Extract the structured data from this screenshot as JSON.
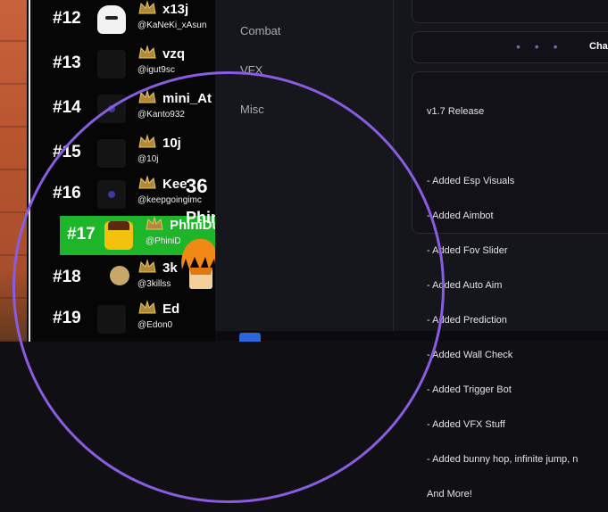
{
  "leaderboard": [
    {
      "rank": "#12",
      "name": "x13j",
      "handle": "@KaNeKi_xAsun",
      "avatar": "ghost"
    },
    {
      "rank": "#13",
      "name": "vzq",
      "handle": "@igut9sc",
      "avatar": "dark"
    },
    {
      "rank": "#14",
      "name": "mini_At",
      "handle": "@Kanto932",
      "avatar": "blue"
    },
    {
      "rank": "#15",
      "name": "10j",
      "handle": "@10j",
      "avatar": "dark"
    },
    {
      "rank": "#16",
      "name": "Kee",
      "handle": "@keepgoingimc",
      "avatar": "blue"
    },
    {
      "rank": "#17",
      "name": "PhiniDu",
      "handle": "@PhiniD",
      "avatar": "face",
      "highlight": true
    },
    {
      "rank": "#18",
      "name": "3k",
      "handle": "@3killss",
      "avatar": "tan"
    },
    {
      "rank": "#19",
      "name": "Ed",
      "handle": "@Edon0",
      "avatar": "dark"
    }
  ],
  "overlay": {
    "kills": "36",
    "player": "Phini"
  },
  "menu": {
    "tabs": [
      "Combat",
      "VFX",
      "Misc"
    ],
    "dots": "• • •",
    "button_label": "Cha",
    "changelog": [
      "v1.7 Release",
      "",
      "- Added Esp Visuals",
      "- Added Aimbot",
      "- Added Fov Slider",
      "- Added Auto Aim",
      "- Added Prediction",
      "- Added Wall Check",
      "- Added Trigger Bot",
      "- Added VFX Stuff",
      "- Added bunny hop, infinite jump, n",
      "And More!"
    ]
  },
  "colors": {
    "highlight": "#1fb52a",
    "accent": "#8a5ce0",
    "panel": "#15151c"
  }
}
